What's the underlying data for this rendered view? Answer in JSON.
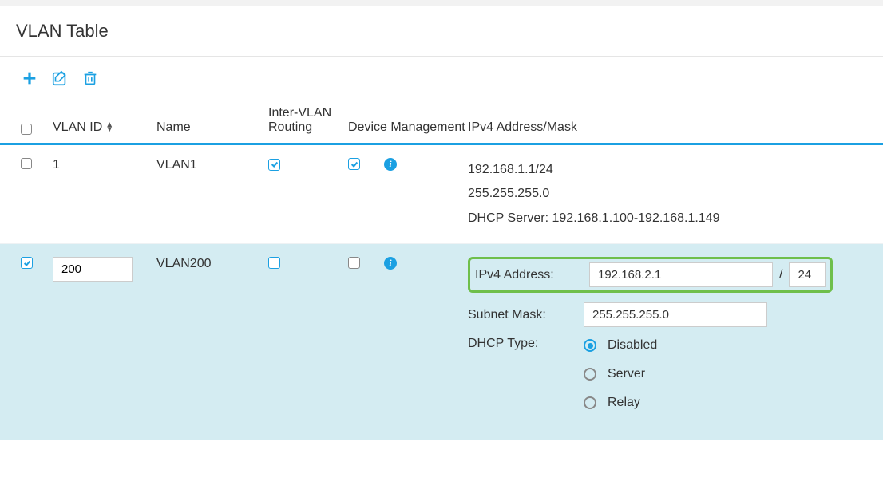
{
  "title": "VLAN Table",
  "columns": {
    "vlan_id": "VLAN ID",
    "name": "Name",
    "inter_vlan_routing": "Inter-VLAN Routing",
    "device_management": "Device Management",
    "ipv4": "IPv4 Address/Mask"
  },
  "rows": [
    {
      "selected": false,
      "vlan_id": "1",
      "name": "VLAN1",
      "inter_vlan_routing": true,
      "device_management": true,
      "ipv4_lines": {
        "addr": "192.168.1.1/24",
        "mask": "255.255.255.0",
        "dhcp": "DHCP Server: 192.168.1.100-192.168.1.149"
      }
    },
    {
      "selected": true,
      "vlan_id": "200",
      "name": "VLAN200",
      "inter_vlan_routing": false,
      "device_management": false,
      "edit": {
        "ipv4_label": "IPv4 Address:",
        "ipv4_value": "192.168.2.1",
        "cidr": "24",
        "subnet_label": "Subnet Mask:",
        "subnet_value": "255.255.255.0",
        "dhcp_label": "DHCP Type:",
        "dhcp_options": [
          "Disabled",
          "Server",
          "Relay"
        ],
        "dhcp_selected": "Disabled"
      }
    }
  ]
}
